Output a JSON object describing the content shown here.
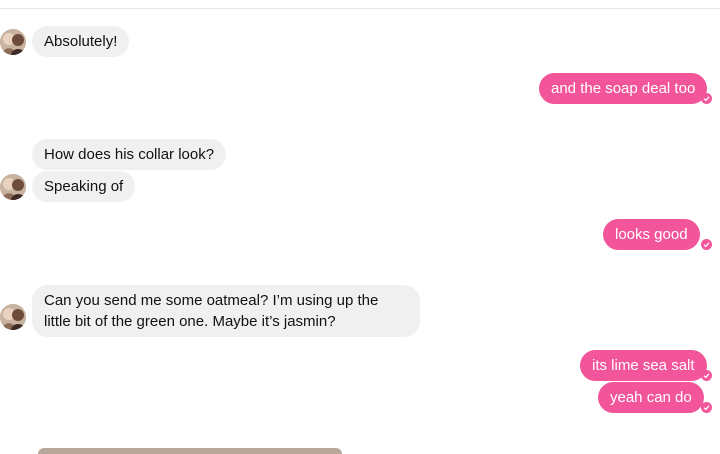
{
  "thread": {
    "messages": [
      {
        "from": "contact",
        "text": "Absolutely!"
      },
      {
        "from": "me",
        "text": "and the soap deal too"
      },
      {
        "from": "contact",
        "text": "How does his collar look?"
      },
      {
        "from": "contact",
        "text": "Speaking of"
      },
      {
        "from": "me",
        "text": "looks good"
      },
      {
        "from": "contact",
        "text": "Can you send me some oatmeal? I’m using up the little bit of the green one. Maybe it’s jasmin?"
      },
      {
        "from": "me",
        "text": "its lime sea salt"
      },
      {
        "from": "me",
        "text": "yeah can do"
      }
    ]
  },
  "colors": {
    "outgoing_bubble": "#f2559a",
    "incoming_bubble": "#f0f0f0",
    "read_receipt": "#f2559a"
  },
  "icons": {
    "avatar": "contact-avatar",
    "read_receipt": "check-circle-icon"
  }
}
